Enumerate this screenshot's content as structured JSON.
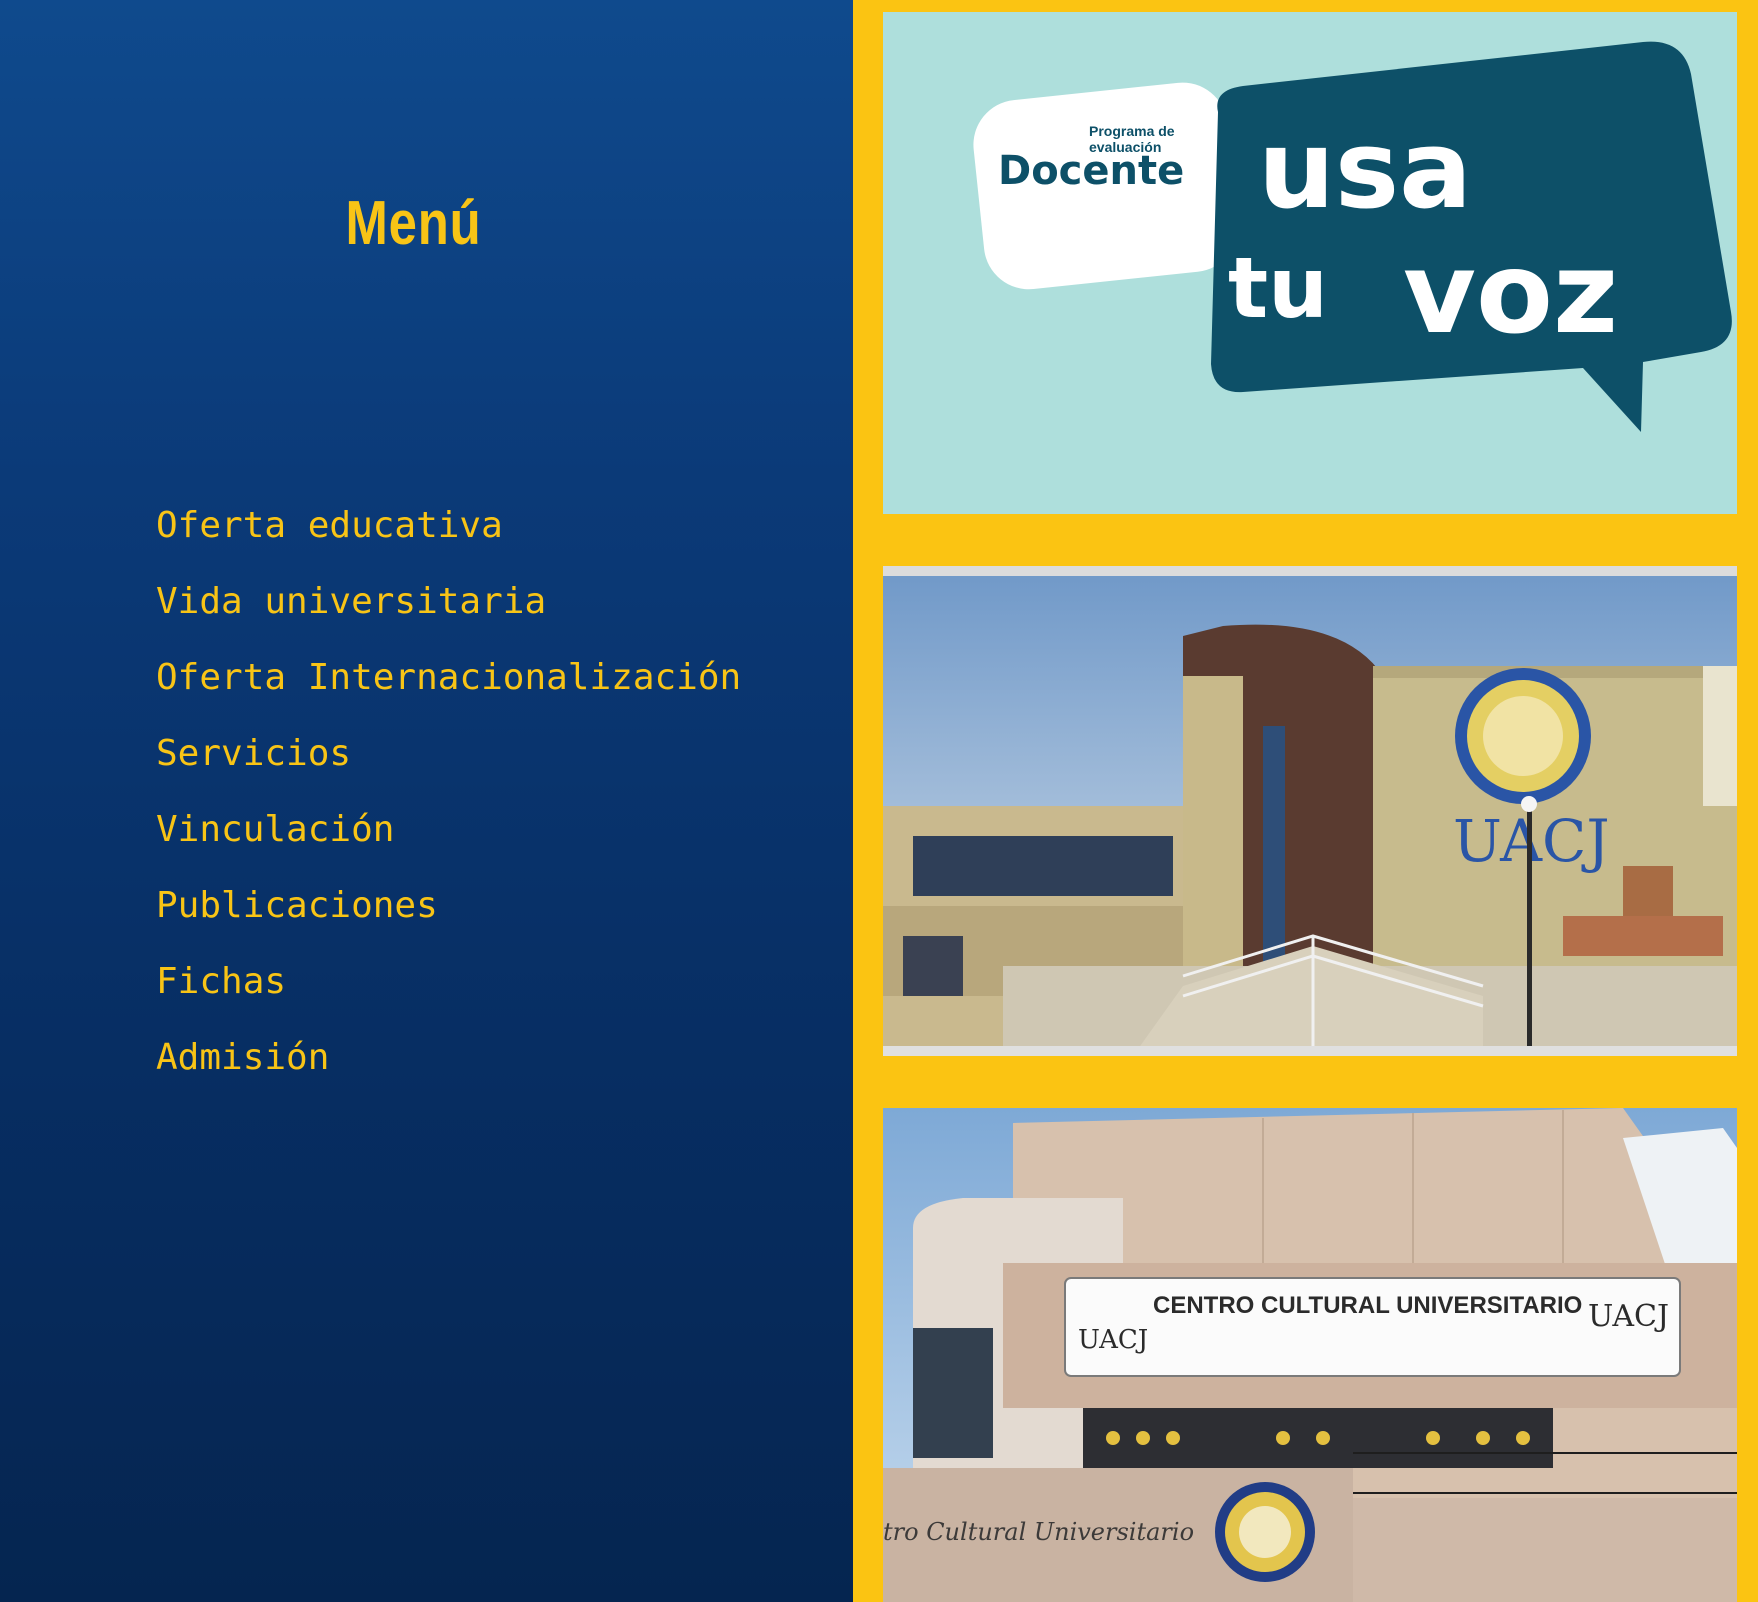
{
  "menu": {
    "title": "Menú",
    "items": [
      {
        "id": "oferta-educativa",
        "label": "Oferta educativa"
      },
      {
        "id": "vida-universitaria",
        "label": "Vida universitaria"
      },
      {
        "id": "oferta-internacionalizacion",
        "label": "Oferta Internacionalización"
      },
      {
        "id": "servicios",
        "label": "Servicios"
      },
      {
        "id": "vinculacion",
        "label": "Vinculación"
      },
      {
        "id": "publicaciones",
        "label": "Publicaciones"
      },
      {
        "id": "fichas",
        "label": "Fichas"
      },
      {
        "id": "admision",
        "label": "Admisión"
      }
    ]
  },
  "tiles": {
    "docente": {
      "program_line1": "Programa de",
      "program_line2": "evaluación",
      "program_word": "Docente",
      "slogan_line1": "usa",
      "slogan_line2a": "tu",
      "slogan_line2b": "voz"
    },
    "campus": {
      "building_sign": "UACJ"
    },
    "cultural": {
      "marquee": "CENTRO CULTURAL UNIVERSITARIO",
      "logo_left": "UACJ",
      "logo_right": "UACJ",
      "wall_text": "tro Cultural Universitario"
    }
  },
  "colors": {
    "menu_bg_top": "#0f4a8d",
    "menu_bg_bottom": "#052550",
    "accent_yellow": "#fbc412",
    "menu_text": "#f8c416",
    "docente_bg": "#aedfdc",
    "bubble_teal": "#0d5068"
  }
}
